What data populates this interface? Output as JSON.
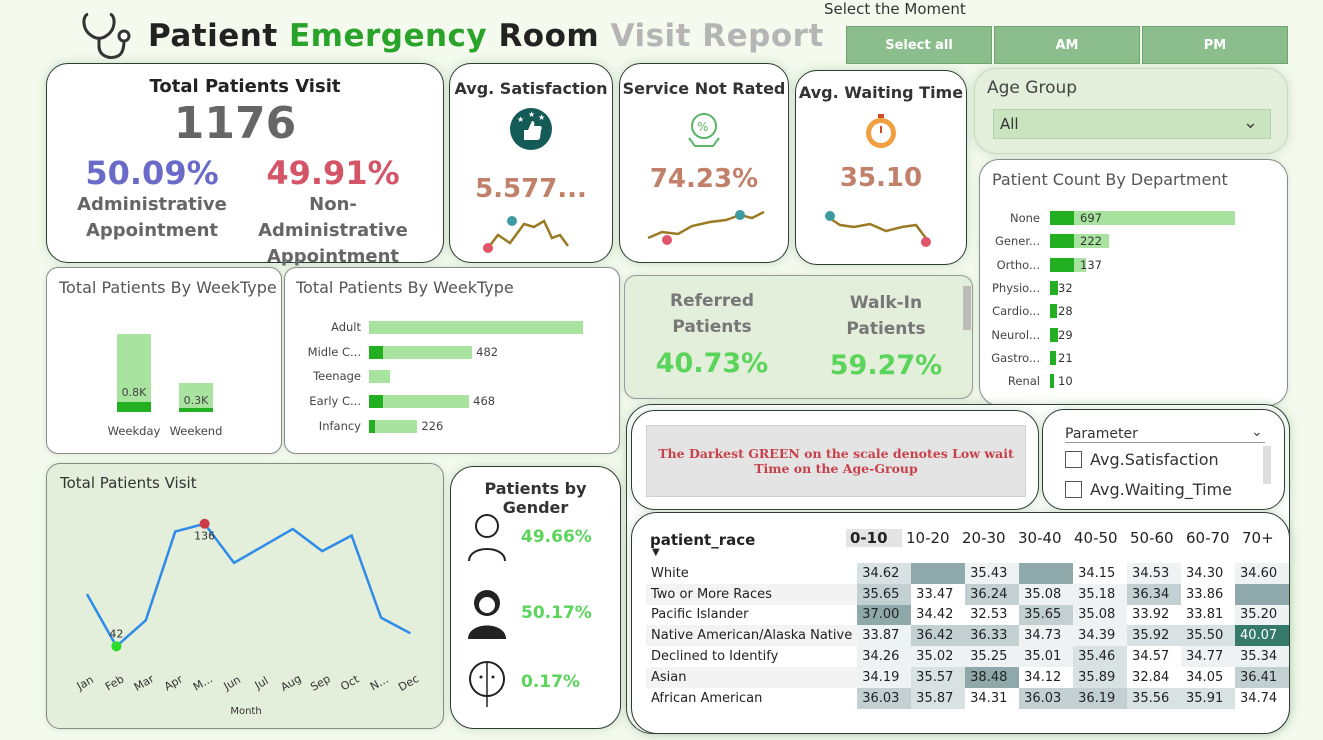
{
  "header": {
    "title_word1": "Patient",
    "title_word2": "Emergency",
    "title_word3": "Room",
    "title_word4": "Visit Report",
    "logo_icon": "stethoscope-icon"
  },
  "moment_slicer": {
    "label": "Select the Moment",
    "buttons": [
      "Select all",
      "AM",
      "PM"
    ]
  },
  "total_visit": {
    "title": "Total Patients Visit",
    "value": "1176",
    "admin_pct": "50.09%",
    "admin_label_1": "Administrative",
    "admin_label_2": "Appointment",
    "nonadmin_pct": "49.91%",
    "nonadmin_label_1": "Non-Administrative",
    "nonadmin_label_2": "Appointment"
  },
  "satisfaction": {
    "title": "Avg. Satisfaction",
    "value": "5.577...",
    "icon": "thumbs-up-stars-icon"
  },
  "not_rated": {
    "title": "Service Not Rated",
    "value": "74.23%",
    "icon": "service-rating-icon"
  },
  "waiting": {
    "title": "Avg. Waiting Time",
    "value": "35.10",
    "icon": "stopwatch-icon"
  },
  "age_group": {
    "title": "Age Group",
    "selected": "All"
  },
  "dept": {
    "title": "Patient Count By Department",
    "rows": [
      {
        "label": "None",
        "value": "697",
        "count": 697
      },
      {
        "label": "Gener...",
        "value": "222",
        "count": 222
      },
      {
        "label": "Ortho...",
        "value": "137",
        "count": 137
      },
      {
        "label": "Physio...",
        "value": "32",
        "count": 32
      },
      {
        "label": "Cardio...",
        "value": "28",
        "count": 28
      },
      {
        "label": "Neurol...",
        "value": "29",
        "count": 29
      },
      {
        "label": "Gastro...",
        "value": "21",
        "count": 21
      },
      {
        "label": "Renal",
        "value": "10",
        "count": 10
      }
    ]
  },
  "weektype": {
    "title": "Total Patients By WeekType",
    "bars": [
      {
        "label": "Weekday",
        "value": "0.8K",
        "count": 0.8
      },
      {
        "label": "Weekend",
        "value": "0.3K",
        "count": 0.3
      }
    ]
  },
  "agegroup_chart": {
    "title": "Total Patients By WeekType",
    "rows": [
      {
        "label": "Adult",
        "value": "",
        "count": 1000
      },
      {
        "label": "Midle C...",
        "value": "482",
        "count": 482
      },
      {
        "label": "Teenage",
        "value": "",
        "count": 100
      },
      {
        "label": "Early C...",
        "value": "468",
        "count": 468
      },
      {
        "label": "Infancy",
        "value": "226",
        "count": 226
      }
    ]
  },
  "referral": {
    "referred_1": "Referred",
    "referred_2": "Patients",
    "referred_pct": "40.73%",
    "walkin_1": "Walk-In",
    "walkin_2": "Patients",
    "walkin_pct": "59.27%"
  },
  "note": {
    "text": "The Darkest GREEN on the scale denotes Low wait Time on the Age-Group"
  },
  "parameter": {
    "title": "Parameter",
    "options": [
      "Avg.Satisfaction",
      "Avg.Waiting_Time"
    ]
  },
  "monthly": {
    "title": "Total Patients Visit",
    "xlabel": "Month",
    "max_label": "136",
    "min_label": "42"
  },
  "gender": {
    "title": "Patients by Gender",
    "rows": [
      {
        "icon": "male-avatar-icon",
        "value": "49.66%"
      },
      {
        "icon": "female-avatar-icon",
        "value": "50.17%"
      },
      {
        "icon": "nonbinary-avatar-icon",
        "value": "0.17%"
      }
    ]
  },
  "heatmap": {
    "row_header": "patient_race",
    "columns": [
      "0-10",
      "10-20",
      "20-30",
      "30-40",
      "40-50",
      "50-60",
      "60-70",
      "70+"
    ],
    "rows": [
      {
        "label": "White",
        "cells": [
          "34.62",
          "",
          "35.43",
          "",
          "34.15",
          "34.53",
          "34.30",
          "34.60"
        ]
      },
      {
        "label": "Two or More Races",
        "cells": [
          "35.65",
          "33.47",
          "36.24",
          "35.08",
          "35.18",
          "36.34",
          "33.86",
          ""
        ]
      },
      {
        "label": "Pacific Islander",
        "cells": [
          "37.00",
          "34.42",
          "32.53",
          "35.65",
          "35.08",
          "33.92",
          "33.81",
          "35.20"
        ]
      },
      {
        "label": "Native American/Alaska Native",
        "cells": [
          "33.87",
          "36.42",
          "36.33",
          "34.73",
          "34.39",
          "35.92",
          "35.50",
          "40.07"
        ]
      },
      {
        "label": "Declined to Identify",
        "cells": [
          "34.26",
          "35.02",
          "35.25",
          "35.01",
          "35.46",
          "34.57",
          "34.77",
          "35.34"
        ]
      },
      {
        "label": "Asian",
        "cells": [
          "34.19",
          "35.57",
          "38.48",
          "34.12",
          "35.89",
          "32.84",
          "34.05",
          "36.41"
        ]
      },
      {
        "label": "African American",
        "cells": [
          "36.03",
          "35.87",
          "34.31",
          "36.03",
          "36.19",
          "35.56",
          "35.91",
          "34.74"
        ]
      }
    ],
    "shade": [
      [
        2,
        5,
        1,
        5,
        0,
        1,
        0,
        1
      ],
      [
        3,
        0,
        3,
        1,
        1,
        3,
        0,
        5
      ],
      [
        5,
        0,
        0,
        3,
        1,
        0,
        0,
        1
      ],
      [
        1,
        3,
        3,
        1,
        1,
        2,
        2,
        6
      ],
      [
        1,
        1,
        1,
        1,
        2,
        0,
        1,
        1
      ],
      [
        1,
        2,
        5,
        0,
        2,
        0,
        0,
        3
      ],
      [
        3,
        2,
        0,
        3,
        3,
        2,
        2,
        0
      ]
    ]
  },
  "chart_data": [
    {
      "type": "line",
      "title": "Total Patients Visit",
      "xlabel": "Month",
      "categories": [
        "Jan",
        "Feb",
        "Mar",
        "Apr",
        "M...",
        "Jun",
        "Jul",
        "Aug",
        "Sep",
        "Oct",
        "N...",
        "Dec"
      ],
      "values": [
        82,
        42,
        62,
        130,
        136,
        106,
        119,
        132,
        115,
        127,
        64,
        52
      ],
      "ylim": [
        30,
        145
      ]
    },
    {
      "type": "bar",
      "title": "Patient Count By Department",
      "categories": [
        "None",
        "Gener...",
        "Ortho...",
        "Physio...",
        "Cardio...",
        "Neurol...",
        "Gastro...",
        "Renal"
      ],
      "values": [
        697,
        222,
        137,
        32,
        28,
        29,
        21,
        10
      ]
    },
    {
      "type": "bar",
      "title": "Total Patients By WeekType",
      "categories": [
        "Weekday",
        "Weekend"
      ],
      "values": [
        0.8,
        0.3
      ]
    }
  ]
}
